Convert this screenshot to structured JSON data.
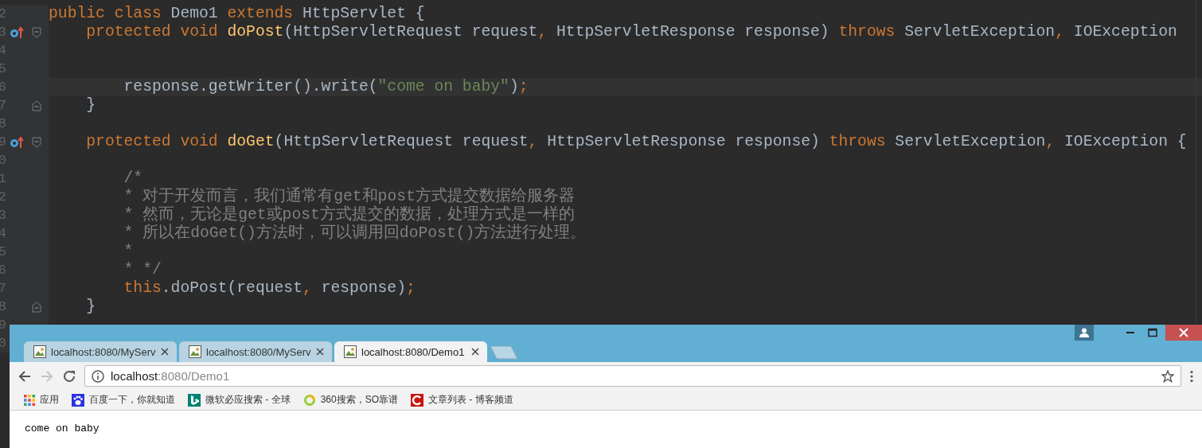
{
  "editor": {
    "lines": [
      {
        "number": "2",
        "override": false,
        "fold_start": false,
        "fold_end": false,
        "current": false,
        "tokens": [
          {
            "kind": "keyword",
            "text": "public class "
          },
          {
            "kind": "plain",
            "text": "Demo1 "
          },
          {
            "kind": "keyword",
            "text": "extends "
          },
          {
            "kind": "plain",
            "text": "HttpServlet {"
          }
        ]
      },
      {
        "number": "3",
        "override": true,
        "fold_start": true,
        "fold_end": false,
        "current": false,
        "tokens": [
          {
            "kind": "keyword",
            "text": "    protected void "
          },
          {
            "kind": "method",
            "text": "doPost"
          },
          {
            "kind": "plain",
            "text": "(HttpServletRequest request"
          },
          {
            "kind": "keyword",
            "text": ", "
          },
          {
            "kind": "plain",
            "text": "HttpServletResponse response) "
          },
          {
            "kind": "keyword",
            "text": "throws "
          },
          {
            "kind": "plain",
            "text": "ServletException"
          },
          {
            "kind": "keyword",
            "text": ", "
          },
          {
            "kind": "plain",
            "text": "IOException"
          }
        ]
      },
      {
        "number": "4",
        "override": false,
        "fold_start": false,
        "fold_end": false,
        "current": false
      },
      {
        "number": "5",
        "override": false,
        "fold_start": false,
        "fold_end": false,
        "current": false
      },
      {
        "number": "6",
        "override": false,
        "fold_start": false,
        "fold_end": false,
        "current": true,
        "tokens": [
          {
            "kind": "plain",
            "text": "        response.getWriter().write("
          },
          {
            "kind": "string",
            "text": "\"come on baby\""
          },
          {
            "kind": "plain",
            "text": ")"
          },
          {
            "kind": "keyword",
            "text": ";"
          }
        ]
      },
      {
        "number": "7",
        "override": false,
        "fold_start": false,
        "fold_end": true,
        "current": false,
        "tokens": [
          {
            "kind": "plain",
            "text": "    }"
          }
        ]
      },
      {
        "number": "8",
        "override": false,
        "fold_start": false,
        "fold_end": false,
        "current": false
      },
      {
        "number": "9",
        "override": true,
        "fold_start": true,
        "fold_end": false,
        "current": false,
        "tokens": [
          {
            "kind": "keyword",
            "text": "    protected void "
          },
          {
            "kind": "method",
            "text": "doGet"
          },
          {
            "kind": "plain",
            "text": "(HttpServletRequest request"
          },
          {
            "kind": "keyword",
            "text": ", "
          },
          {
            "kind": "plain",
            "text": "HttpServletResponse response) "
          },
          {
            "kind": "keyword",
            "text": "throws "
          },
          {
            "kind": "plain",
            "text": "ServletException"
          },
          {
            "kind": "keyword",
            "text": ", "
          },
          {
            "kind": "plain",
            "text": "IOException {"
          }
        ]
      },
      {
        "number": "0",
        "override": false,
        "fold_start": false,
        "fold_end": false,
        "current": false
      },
      {
        "number": "1",
        "override": false,
        "fold_start": false,
        "fold_end": false,
        "current": false,
        "tokens": [
          {
            "kind": "comment",
            "text": "        /*"
          }
        ]
      },
      {
        "number": "2",
        "override": false,
        "fold_start": false,
        "fold_end": false,
        "current": false,
        "tokens": [
          {
            "kind": "comment",
            "text": "        * 对于开发而言，我们通常有get和post方式提交数据给服务器"
          }
        ]
      },
      {
        "number": "3",
        "override": false,
        "fold_start": false,
        "fold_end": false,
        "current": false,
        "tokens": [
          {
            "kind": "comment",
            "text": "        * 然而，无论是get或post方式提交的数据，处理方式是一样的"
          }
        ]
      },
      {
        "number": "4",
        "override": false,
        "fold_start": false,
        "fold_end": false,
        "current": false,
        "tokens": [
          {
            "kind": "comment",
            "text": "        * 所以在doGet()方法时，可以调用回doPost()方法进行处理。"
          }
        ]
      },
      {
        "number": "5",
        "override": false,
        "fold_start": false,
        "fold_end": false,
        "current": false,
        "tokens": [
          {
            "kind": "comment",
            "text": "        *"
          }
        ]
      },
      {
        "number": "6",
        "override": false,
        "fold_start": false,
        "fold_end": false,
        "current": false,
        "tokens": [
          {
            "kind": "comment",
            "text": "        * */"
          }
        ]
      },
      {
        "number": "7",
        "override": false,
        "fold_start": false,
        "fold_end": false,
        "current": false,
        "tokens": [
          {
            "kind": "keyword",
            "text": "        this"
          },
          {
            "kind": "plain",
            "text": ".doPost(request"
          },
          {
            "kind": "keyword",
            "text": ", "
          },
          {
            "kind": "plain",
            "text": "response)"
          },
          {
            "kind": "keyword",
            "text": ";"
          }
        ]
      },
      {
        "number": "8",
        "override": false,
        "fold_start": false,
        "fold_end": true,
        "current": false,
        "tokens": [
          {
            "kind": "plain",
            "text": "    }"
          }
        ]
      },
      {
        "number": "9",
        "override": false,
        "fold_start": false,
        "fold_end": false,
        "current": false
      },
      {
        "number": "0",
        "override": false,
        "fold_start": false,
        "fold_end": false,
        "current": false
      }
    ]
  },
  "browser": {
    "tabs": [
      {
        "title": "localhost:8080/MyServ",
        "selected": false
      },
      {
        "title": "localhost:8080/MyServ",
        "selected": false
      },
      {
        "title": "localhost:8080/Demo1",
        "selected": true
      }
    ],
    "forward_disabled": true,
    "address": {
      "host": "localhost",
      "path": ":8080/Demo1"
    },
    "bookmarks": [
      {
        "kind": "apps",
        "label": "应用"
      },
      {
        "kind": "paw",
        "label": "百度一下，你就知道"
      },
      {
        "kind": "bing",
        "label": "微软必应搜索 - 全球"
      },
      {
        "kind": "ring",
        "label": "360搜索，SO靠谱"
      },
      {
        "kind": "red",
        "label": "文章列表 - 博客频道"
      }
    ],
    "content": "come on baby"
  }
}
